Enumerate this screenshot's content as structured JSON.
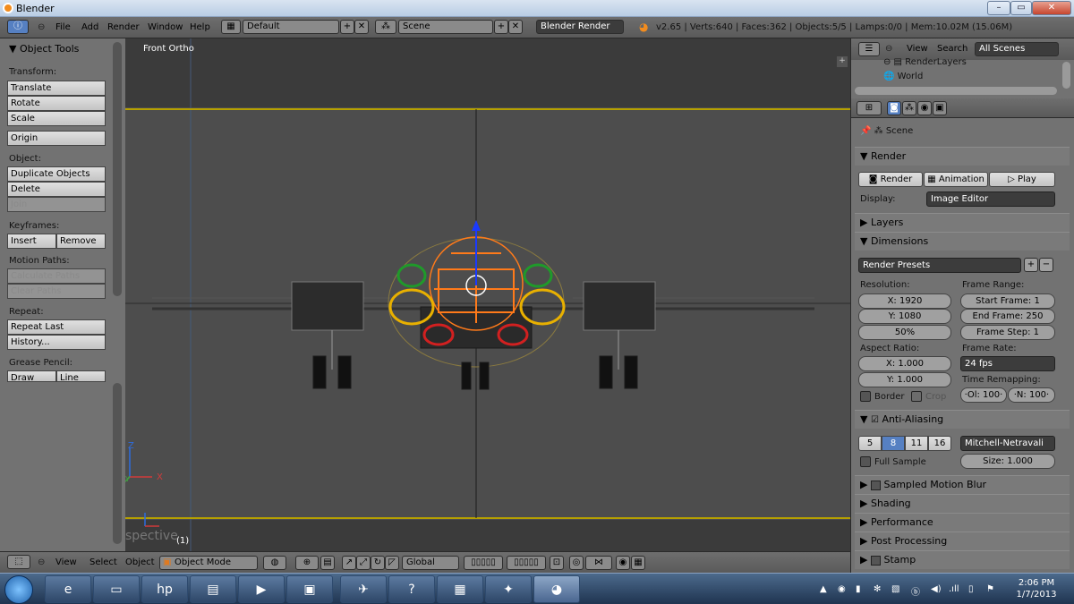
{
  "window": {
    "title": "Blender",
    "minimize": "–",
    "maximize": "▭",
    "close": "✕"
  },
  "header": {
    "menus": [
      "File",
      "Add",
      "Render",
      "Window",
      "Help"
    ],
    "screen_layout": "Default",
    "scene": "Scene",
    "engine": "Blender Render",
    "status": "v2.65 | Verts:640 | Faces:362 | Objects:5/5 | Lamps:0/0 | Mem:10.02M (15.06M)"
  },
  "toolshelf": {
    "title": "Object Tools",
    "transform_label": "Transform:",
    "transform": [
      "Translate",
      "Rotate",
      "Scale"
    ],
    "origin": "Origin",
    "object_label": "Object:",
    "object": [
      "Duplicate Objects",
      "Delete",
      "Join"
    ],
    "keyframes_label": "Keyframes:",
    "insert": "Insert",
    "remove": "Remove",
    "motion_label": "Motion Paths:",
    "motion": [
      "Calculate Paths",
      "Clear Paths"
    ],
    "repeat_label": "Repeat:",
    "repeat": [
      "Repeat Last",
      "History..."
    ],
    "grease_label": "Grease Pencil:",
    "draw": "Draw",
    "line": "Line"
  },
  "viewport": {
    "view_name": "Front Ortho",
    "persp_ghost": "spective",
    "frame": "(1)",
    "axis_z": "Z",
    "axis_x": "X",
    "axis_y": "Y"
  },
  "vpheader": {
    "menus": [
      "View",
      "Select",
      "Object"
    ],
    "mode": "Object Mode",
    "orientation": "Global"
  },
  "outliner": {
    "view": "View",
    "search": "Search",
    "scenes": "All Scenes",
    "items": [
      "RenderLayers",
      "World"
    ]
  },
  "properties": {
    "scene": "Scene",
    "render_section": "Render",
    "render_btn": "Render",
    "animation_btn": "Animation",
    "play_btn": "Play",
    "display_label": "Display:",
    "display_value": "Image Editor",
    "layers": "Layers",
    "dimensions": "Dimensions",
    "render_presets": "Render Presets",
    "resolution_label": "Resolution:",
    "res_x": "X: 1920",
    "res_y": "Y: 1080",
    "res_pct": "50%",
    "frame_range_label": "Frame Range:",
    "start_frame": "Start Frame: 1",
    "end_frame": "End Frame: 250",
    "frame_step": "Frame Step: 1",
    "aspect_label": "Aspect Ratio:",
    "aspect_x": "X: 1.000",
    "aspect_y": "Y: 1.000",
    "frame_rate_label": "Frame Rate:",
    "fps": "24 fps",
    "time_remap_label": "Time Remapping:",
    "remap_old": "·Ol: 100·",
    "remap_new": "·N: 100·",
    "border": "Border",
    "crop": "Crop",
    "anti_aliasing": "Anti-Aliasing",
    "aa_samples": [
      "5",
      "8",
      "11",
      "16"
    ],
    "aa_selected": "8",
    "filter": "Mitchell-Netravali",
    "full_sample": "Full Sample",
    "size": "Size: 1.000",
    "sampled_motion_blur": "Sampled Motion Blur",
    "shading": "Shading",
    "performance": "Performance",
    "post_processing": "Post Processing",
    "stamp": "Stamp"
  },
  "taskbar": {
    "time": "2:06 PM",
    "date": "1/7/2013"
  },
  "colors": {
    "selection_orange": "#ff7a1a",
    "ring_green": "#1f9a2a",
    "ring_yellow": "#e8b000",
    "ring_red": "#d22020",
    "frame_line": "#b6a000",
    "selected_blue": "#5680c2"
  }
}
